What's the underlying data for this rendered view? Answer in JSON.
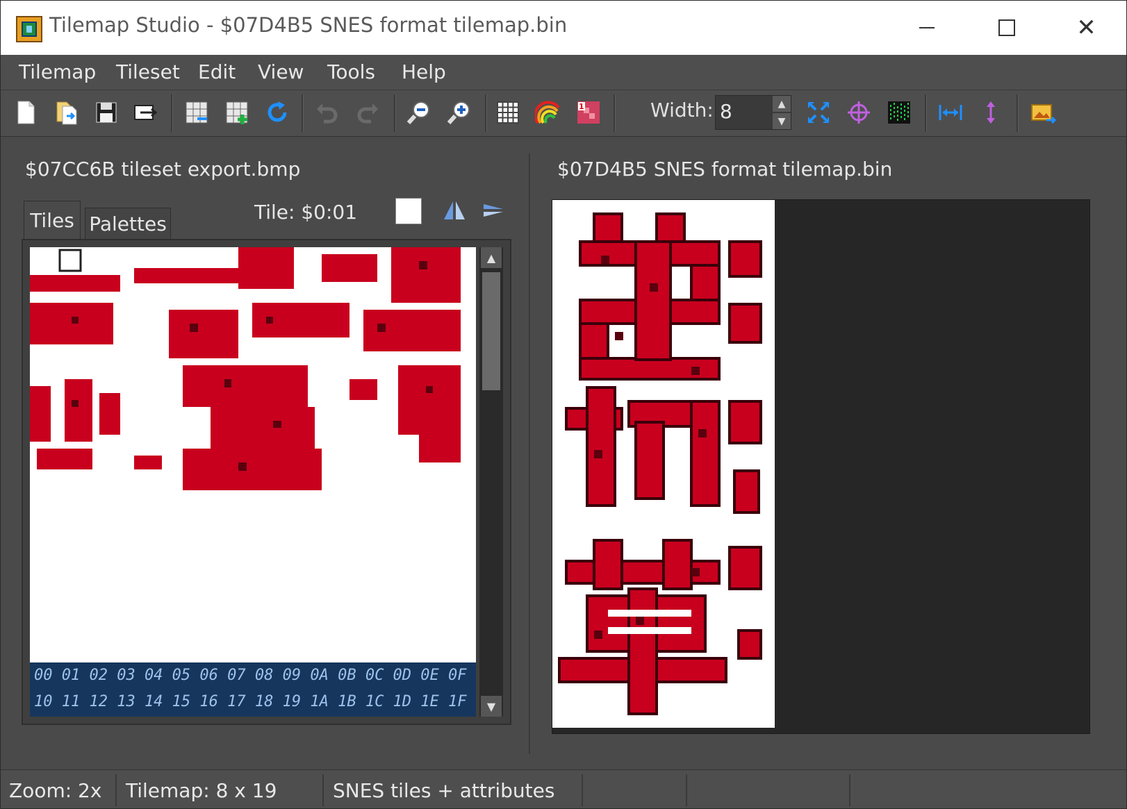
{
  "window": {
    "title": "Tilemap Studio - $07D4B5 SNES format tilemap.bin",
    "app_icon": "tilemap-studio-icon"
  },
  "menu": [
    {
      "label": "Tilemap"
    },
    {
      "label": "Tileset"
    },
    {
      "label": "Edit"
    },
    {
      "label": "View"
    },
    {
      "label": "Tools"
    },
    {
      "label": "Help"
    }
  ],
  "toolbar": {
    "width_label": "Width:",
    "width_value": "8",
    "icons": [
      "new-file-icon",
      "open-file-icon",
      "save-icon",
      "export-icon",
      "load-tileset-icon",
      "add-tileset-icon",
      "reload-icon",
      "undo-icon",
      "redo-icon",
      "zoom-out-icon",
      "zoom-in-icon",
      "grid-icon",
      "rainbow-icon",
      "tile-id-icon",
      "resize-icon",
      "center-icon",
      "priority-icon",
      "flip-horizontal-icon",
      "flip-vertical-icon",
      "image-export-icon"
    ]
  },
  "tileset": {
    "title": "$07CC6B tileset export.bmp",
    "tabs": [
      {
        "label": "Tiles"
      },
      {
        "label": "Palettes"
      }
    ],
    "tile_label": "Tile: $0:01",
    "hex_rows": [
      "00 01 02 03 04 05 06 07 08 09 0A 0B 0C 0D 0E 0F",
      "10 11 12 13 14 15 16 17 18 19 1A 1B 1C 1D 1E 1F"
    ]
  },
  "tilemap": {
    "title": "$07D4B5 SNES format tilemap.bin",
    "glyph_color": "#c8001e"
  },
  "status": {
    "zoom": "Zoom: 2x",
    "tilemap_size": "Tilemap: 8 x 19",
    "format": "SNES tiles + attributes"
  },
  "colors": {
    "bg": "#4a4a4a",
    "accent_blue": "#1e90ff",
    "glyph_red": "#c8001e"
  }
}
